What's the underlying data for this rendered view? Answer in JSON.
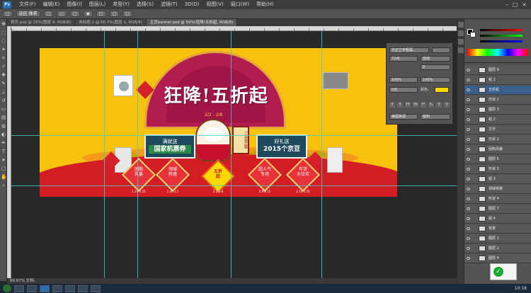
{
  "app": {
    "logo": "Ps",
    "menu": [
      "文件(F)",
      "编辑(E)",
      "图像(I)",
      "图层(L)",
      "类型(Y)",
      "选择(S)",
      "滤镜(T)",
      "3D(D)",
      "视图(V)",
      "窗口(W)",
      "帮助(H)"
    ],
    "window_controls": [
      "–",
      "□",
      "×"
    ]
  },
  "options_bar": {
    "items": [
      "□",
      "选区 像素",
      "□",
      "□",
      "□",
      "◉",
      "□",
      "□",
      "□"
    ]
  },
  "tabs": [
    {
      "label": "首页.psd @ 25%(图层 9, RGB/8)",
      "active": false
    },
    {
      "label": "未标题-1 @ 66.7%(图层 1, RGB/8)",
      "active": false
    },
    {
      "label": "主页banner.psd @ 50%(狂降!五折起, RGB/8)",
      "active": true
    }
  ],
  "status": {
    "zoom": "66.67%",
    "doc": "文档:"
  },
  "banner": {
    "title": "狂降!五折起",
    "date": "2/2 - 2/8",
    "left_scroll": {
      "line1": "满就送",
      "line2": "国家机票券"
    },
    "right_scroll": {
      "line1": "好礼送",
      "line2": "2015个京豆"
    },
    "mascot_scroll": "三羊开泰",
    "diamonds": [
      {
        "label": "团购\n风暴",
        "date": "1.19-1.25",
        "center": false
      },
      {
        "label": "领域\n特惠",
        "date": "1.26-2.1",
        "center": false
      },
      {
        "label": "五折\n起",
        "date": "2.2-2.8",
        "center": true
      },
      {
        "label": "超人气\n专场",
        "date": "2.9-2.15",
        "center": false
      },
      {
        "label": "年货\n大狂欢",
        "date": "2.15-2.25",
        "center": false
      }
    ]
  },
  "char_panel": {
    "font": "方正兰亭粗黑...",
    "style": "-",
    "size": "72点",
    "leading": "自动",
    "tracking": "0",
    "scale_v": "100%",
    "scale_h": "100%",
    "baseline": "0点",
    "color_label": "颜色:",
    "style_buttons": [
      "T",
      "T",
      "TT",
      "Tt",
      "T¹",
      "T₁",
      "T",
      "T"
    ],
    "lang": "美国英语",
    "aa": "锐利"
  },
  "layers": [
    {
      "name": "图层 9",
      "selected": false
    },
    {
      "name": "组 1",
      "selected": false
    },
    {
      "name": "五折起",
      "selected": true
    },
    {
      "name": "形状 1",
      "selected": false
    },
    {
      "name": "图层 3",
      "selected": false
    },
    {
      "name": "组 2",
      "selected": false
    },
    {
      "name": "文字",
      "selected": false
    },
    {
      "name": "形状 2",
      "selected": false
    },
    {
      "name": "团购风暴",
      "selected": false
    },
    {
      "name": "图层 5",
      "selected": false
    },
    {
      "name": "形状 3",
      "selected": false
    },
    {
      "name": "组 3",
      "selected": false
    },
    {
      "name": "领域特惠",
      "selected": false
    },
    {
      "name": "形状 4",
      "selected": false
    },
    {
      "name": "图层 7",
      "selected": false
    },
    {
      "name": "组 4",
      "selected": false
    },
    {
      "name": "背景",
      "selected": false
    },
    {
      "name": "图层 1",
      "selected": false
    },
    {
      "name": "图层 2",
      "selected": false
    },
    {
      "name": "图层 4",
      "selected": false
    }
  ],
  "taskbar": {
    "time": "10:18"
  },
  "colors": {
    "banner_yellow": "#f7c20d",
    "banner_red": "#d21d24",
    "guide": "#3fd1c8",
    "fan": "#b21d4f"
  }
}
